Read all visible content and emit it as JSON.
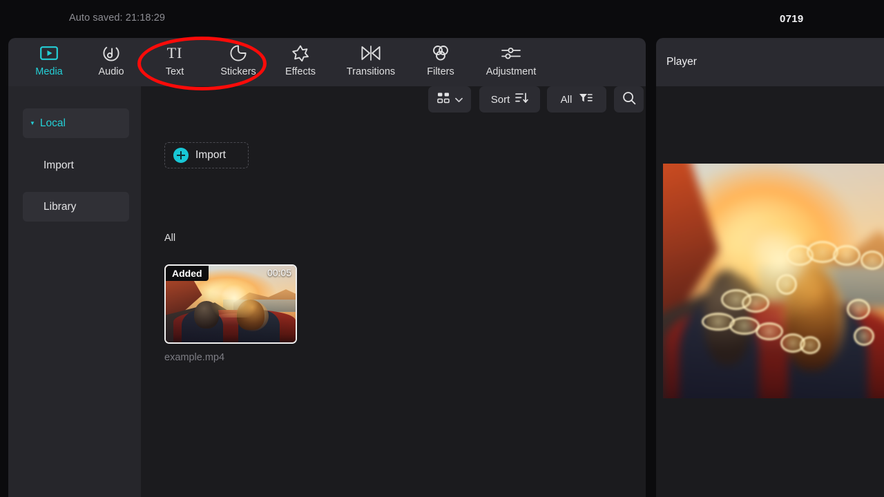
{
  "topbar": {
    "autosave_text": "Auto saved: 21:18:29",
    "project_title": "0719"
  },
  "tabs": [
    {
      "id": "media",
      "label": "Media",
      "icon": "video-play-icon",
      "active": true
    },
    {
      "id": "audio",
      "label": "Audio",
      "icon": "music-note-icon",
      "active": false
    },
    {
      "id": "text",
      "label": "Text",
      "icon": "text-ti-icon",
      "active": false
    },
    {
      "id": "stickers",
      "label": "Stickers",
      "icon": "sticker-icon",
      "active": false
    },
    {
      "id": "effects",
      "label": "Effects",
      "icon": "sparkle-star-icon",
      "active": false
    },
    {
      "id": "transitions",
      "label": "Transitions",
      "icon": "transition-icon",
      "active": false
    },
    {
      "id": "filters",
      "label": "Filters",
      "icon": "three-circles-icon",
      "active": false
    },
    {
      "id": "adjustment",
      "label": "Adjustment",
      "icon": "sliders-icon",
      "active": false
    }
  ],
  "annotation": {
    "shape": "ellipse",
    "color": "#fb0b09",
    "targets": "Text and Stickers tabs"
  },
  "sidebar": {
    "items": [
      {
        "id": "local",
        "label": "Local",
        "type": "group",
        "expanded": true
      },
      {
        "id": "import",
        "label": "Import",
        "type": "item",
        "selected": false
      },
      {
        "id": "library",
        "label": "Library",
        "type": "item",
        "selected": true
      }
    ]
  },
  "content": {
    "import_button_label": "Import",
    "section_label": "All",
    "toolbar": {
      "view_mode_icon": "grid-view-icon",
      "view_mode_chevron": "chevron-down-icon",
      "sort_label": "Sort",
      "sort_icon": "sort-descending-icon",
      "filter_label": "All",
      "filter_icon": "funnel-filter-icon",
      "search_icon": "search-icon"
    },
    "media_items": [
      {
        "name": "example.mp4",
        "badge": "Added",
        "duration": "00:05",
        "selected": true
      }
    ]
  },
  "player": {
    "title": "Player"
  },
  "colors": {
    "accent": "#24cfd6",
    "annotation": "#fb0b09",
    "panel_bg": "#1b1b1e",
    "tabbar_bg": "#2a2a30",
    "sidebar_bg": "#26262b",
    "app_bg": "#0b0b0d"
  }
}
